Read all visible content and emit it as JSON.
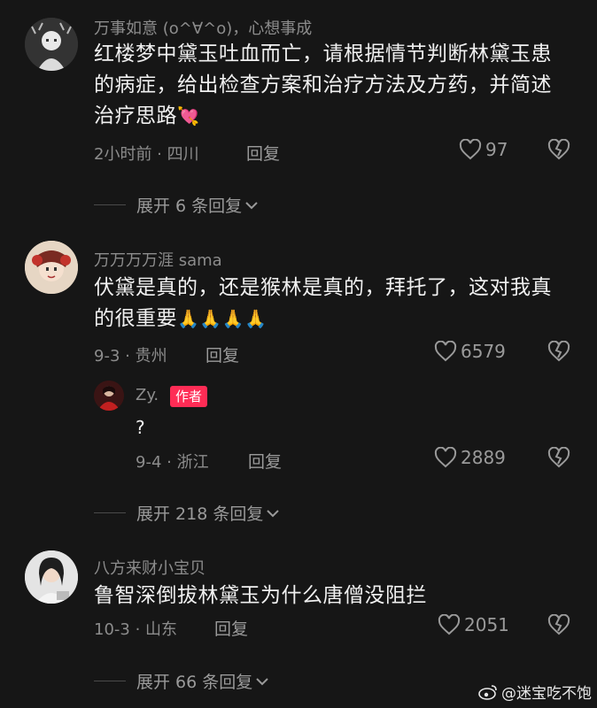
{
  "comments": [
    {
      "username": "万事如意 (o^∀^o)，心想事成",
      "text": "红楼梦中黛玉吐血而亡，请根据情节判断林黛玉患的病症，给出检查方案和治疗方法及方药，并简述治疗思路",
      "text_emoji": "💘",
      "time_location": "2小时前 · 四川",
      "reply_label": "回复",
      "likes": "97",
      "expand_label": "展开 6 条回复"
    },
    {
      "username": "万万万万涯 sama",
      "text": "伏黛是真的，还是猴林是真的，拜托了，这对我真的很重要",
      "text_emoji": "🙏🙏🙏🙏",
      "time_location": "9-3 · 贵州",
      "reply_label": "回复",
      "likes": "6579",
      "reply": {
        "username": "Zy.",
        "badge": "作者",
        "text": "?",
        "time_location": "9-4 · 浙江",
        "reply_label": "回复",
        "likes": "2889"
      },
      "expand_label": "展开 218 条回复"
    },
    {
      "username": "八方来财小宝贝",
      "text": "鲁智深倒拔林黛玉为什么唐僧没阻拦",
      "time_location": "10-3 · 山东",
      "reply_label": "回复",
      "likes": "2051",
      "expand_label": "展开 66 条回复"
    }
  ],
  "watermark": "@迷宝吃不饱",
  "icons": {
    "like": "heart-outline-icon",
    "dislike": "broken-heart-icon",
    "expand": "chevron-down-icon",
    "watermark": "weibo-logo-icon"
  },
  "colors": {
    "background": "#161616",
    "author_badge": "#fe2c55",
    "muted_text": "#8c8c8c"
  }
}
